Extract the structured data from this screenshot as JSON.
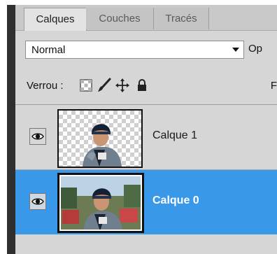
{
  "tabs": [
    {
      "label": "Calques",
      "active": true
    },
    {
      "label": "Couches",
      "active": false
    },
    {
      "label": "Tracés",
      "active": false
    }
  ],
  "blend": {
    "value": "Normal",
    "opacity_label": "Op"
  },
  "lock": {
    "label": "Verrou :",
    "fill_label": "F",
    "icons": [
      "lock-transparent-pixels-icon",
      "lock-image-pixels-icon",
      "lock-position-icon",
      "lock-all-icon"
    ]
  },
  "layers": [
    {
      "name": "Calque 1",
      "visible": true,
      "selected": false
    },
    {
      "name": "Calque 0",
      "visible": true,
      "selected": true
    }
  ],
  "colors": {
    "selected": "#3a98e8",
    "panel": "#d6d6d6"
  }
}
